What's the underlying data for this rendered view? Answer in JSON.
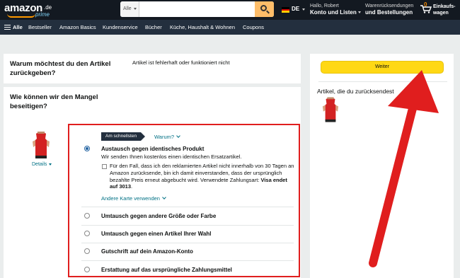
{
  "header": {
    "logo_text": "amazon",
    "logo_tld": ".de",
    "logo_sub": "prime",
    "search_category": "Alle",
    "search_placeholder": "",
    "language": "DE",
    "account_greeting": "Hallo, Robert",
    "account_label": "Konto und Listen",
    "orders_line1": "Warenrücksendungen",
    "orders_line2": "und Bestellungen",
    "cart_count": "0",
    "cart_line1": "Einkaufs-",
    "cart_line2": "wagen"
  },
  "nav": {
    "all_label": "Alle",
    "items": [
      "Bestseller",
      "Amazon Basics",
      "Kundenservice",
      "Bücher",
      "Küche, Haushalt & Wohnen",
      "Coupons"
    ]
  },
  "return": {
    "question_reason": "Warum möchtest du den Artikel zurückgeben?",
    "question_reason_lines": [
      "Warum möchtest du den Artikel",
      "zurückgeben?"
    ],
    "selected_reason": "Artikel ist fehlerhaft oder funktioniert nicht",
    "question_fix_lines": [
      "Wie können wir den Mangel",
      "beseitigen?"
    ],
    "details_label": "Details",
    "fastest_badge": "Am schnellsten",
    "why_link": "Warum?",
    "options": [
      {
        "title": "Austausch gegen identisches Produkt",
        "selected": true
      },
      {
        "title": "Umtausch gegen andere Größe oder Farbe",
        "selected": false
      },
      {
        "title": "Umtausch gegen einen Artikel Ihrer Wahl",
        "selected": false
      },
      {
        "title": "Gutschrift auf dein Amazon-Konto",
        "selected": false
      },
      {
        "title": "Erstattung auf das ursprüngliche Zahlungsmittel",
        "selected": false
      }
    ],
    "option1_subtitle": "Wir senden Ihnen kostenlos einen identischen Ersatzartikel.",
    "consent_text": "Für den Fall, dass ich den reklamierten Artikel nicht innerhalb von 30 Tagen an Amazon zurücksende, bin ich damit einverstanden, dass der ursprünglich bezahlte Preis erneut abgebucht wird. Verwendete Zahlungsart: ",
    "consent_payment": "Visa endet auf 3013",
    "consent_end": ".",
    "other_card_link": "Andere Karte verwenden"
  },
  "sidebar": {
    "continue_button": "Weiter",
    "items_title": "Artikel, die du zurücksendest"
  },
  "colors": {
    "header_bg": "#131921",
    "nav_bg": "#232f3e",
    "accent_orange": "#febd69",
    "button_yellow": "#ffd814",
    "link": "#007185",
    "annotation_red": "#e01e1e",
    "radio_blue": "#2162a1"
  }
}
